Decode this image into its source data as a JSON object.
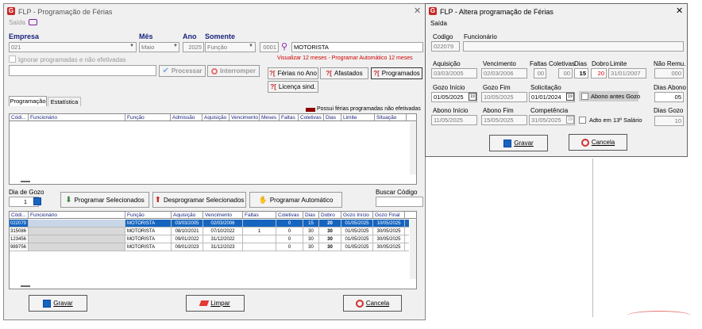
{
  "main": {
    "title": "FLP - Programação de Férias",
    "menu_saida": "Saída",
    "empresa_label": "Empresa",
    "empresa_value": "021",
    "mes_label": "Mês",
    "mes_value": "Maio",
    "ano_label": "Ano",
    "ano_value": "2025",
    "somente_label": "Somente",
    "somente_value": "Função",
    "funcao_code": "0001",
    "funcao_name": "MOTORISTA",
    "ignorar_label": "Ignorar programadas e não efetivadas",
    "visualizar_text": "Visualizar 12 meses - Programar Automático 12 meses",
    "processar_label": "Processar",
    "interromper_label": "Interromper",
    "ferias_ano_label": "Férias no Ano",
    "afastados_label": "Afastados",
    "programados_label": "Programados",
    "licenca_label": "Licença sind.",
    "tab_programacao": "Programação",
    "tab_estatistica": "Estatística",
    "possui_text": "Possui férias programadas não efetivadas",
    "top_headers": [
      "Códi...",
      "Funcionário",
      "Função",
      "Admissão",
      "Aquisição",
      "Vencimento",
      "Meses",
      "Faltas",
      "Coletivas",
      "Dias",
      "Limite",
      "Situação"
    ],
    "dia_gozo_label": "Dia de Gozo",
    "dia_gozo_value": "1",
    "programar_sel_label": "Programar Selecionados",
    "desprogramar_label": "Desprogramar Selecionados",
    "programar_auto_label": "Programar Automático",
    "buscar_label": "Buscar Código",
    "bottom_headers": [
      "Códi...",
      "Funcionário",
      "Função",
      "Aquisição",
      "Vencimento",
      "Faltas",
      "Coletivas",
      "Dias",
      "Dobro",
      "Gozo Início",
      "Gozo Final"
    ],
    "rows": [
      [
        "022079",
        "",
        "MOTORISTA",
        "03/03/2005",
        "02/03/2006",
        "",
        "0",
        "15",
        "20",
        "01/05/2025",
        "10/05/2025"
      ],
      [
        "315086",
        "",
        "MOTORISTA",
        "08/10/2021",
        "07/10/2022",
        "1",
        "0",
        "30",
        "30",
        "01/05/2025",
        "30/05/2025"
      ],
      [
        "123456",
        "",
        "MOTORISTA",
        "09/01/2022",
        "31/12/2022",
        "",
        "0",
        "30",
        "30",
        "01/05/2025",
        "30/05/2025"
      ],
      [
        "989756",
        "",
        "MOTORISTA",
        "09/01/2023",
        "31/12/2023",
        "",
        "0",
        "30",
        "30",
        "01/05/2025",
        "30/05/2025"
      ]
    ],
    "gravar_label": "Gravar",
    "limpar_label": "Limpar",
    "cancela_label": "Cancela"
  },
  "dialog": {
    "title": "FLP - Altera programação de Férias",
    "menu_saida": "Saída",
    "codigo_label": "Codigo",
    "codigo_value": "022079",
    "funcionario_label": "Funcionário",
    "aquisicao_label": "Aquisição",
    "aquisicao_value": "03/03/2005",
    "vencimento_label": "Vencimento",
    "vencimento_value": "02/03/2006",
    "faltas_label": "Faltas",
    "faltas_value": "00",
    "coletivas_label": "Coletivas",
    "coletivas_value": "00",
    "dias_label": "Dias",
    "dias_value": "15",
    "dobro_label": "Dobro",
    "dobro_value": "20",
    "limite_label": "Limite",
    "limite_value": "31/01/2007",
    "nao_remu_label": "Não Remu.",
    "nao_remu_value": "000",
    "gozo_inicio_label": "Gozo Início",
    "gozo_inicio_value": "01/05/2025",
    "gozo_fim_label": "Gozo Fim",
    "gozo_fim_value": "10/05/2025",
    "solicitacao_label": "Solicitação",
    "solicitacao_value": "01/01/2024",
    "abono_antes_label": "Abono antes Gozo",
    "dias_abono_label": "Dias Abono",
    "dias_abono_value": "05",
    "abono_inicio_label": "Abono Início",
    "abono_inicio_value": "11/05/2025",
    "abono_fim_label": "Abono Fim",
    "abono_fim_value": "15/05/2025",
    "competencia_label": "Competência",
    "competencia_value": "31/05/2025",
    "adto_label": "Adto em 13º Salário",
    "dias_gozo_label": "Dias Gozo",
    "dias_gozo_value": "10",
    "gravar_label": "Gravar",
    "cancela_label": "Cancela"
  }
}
